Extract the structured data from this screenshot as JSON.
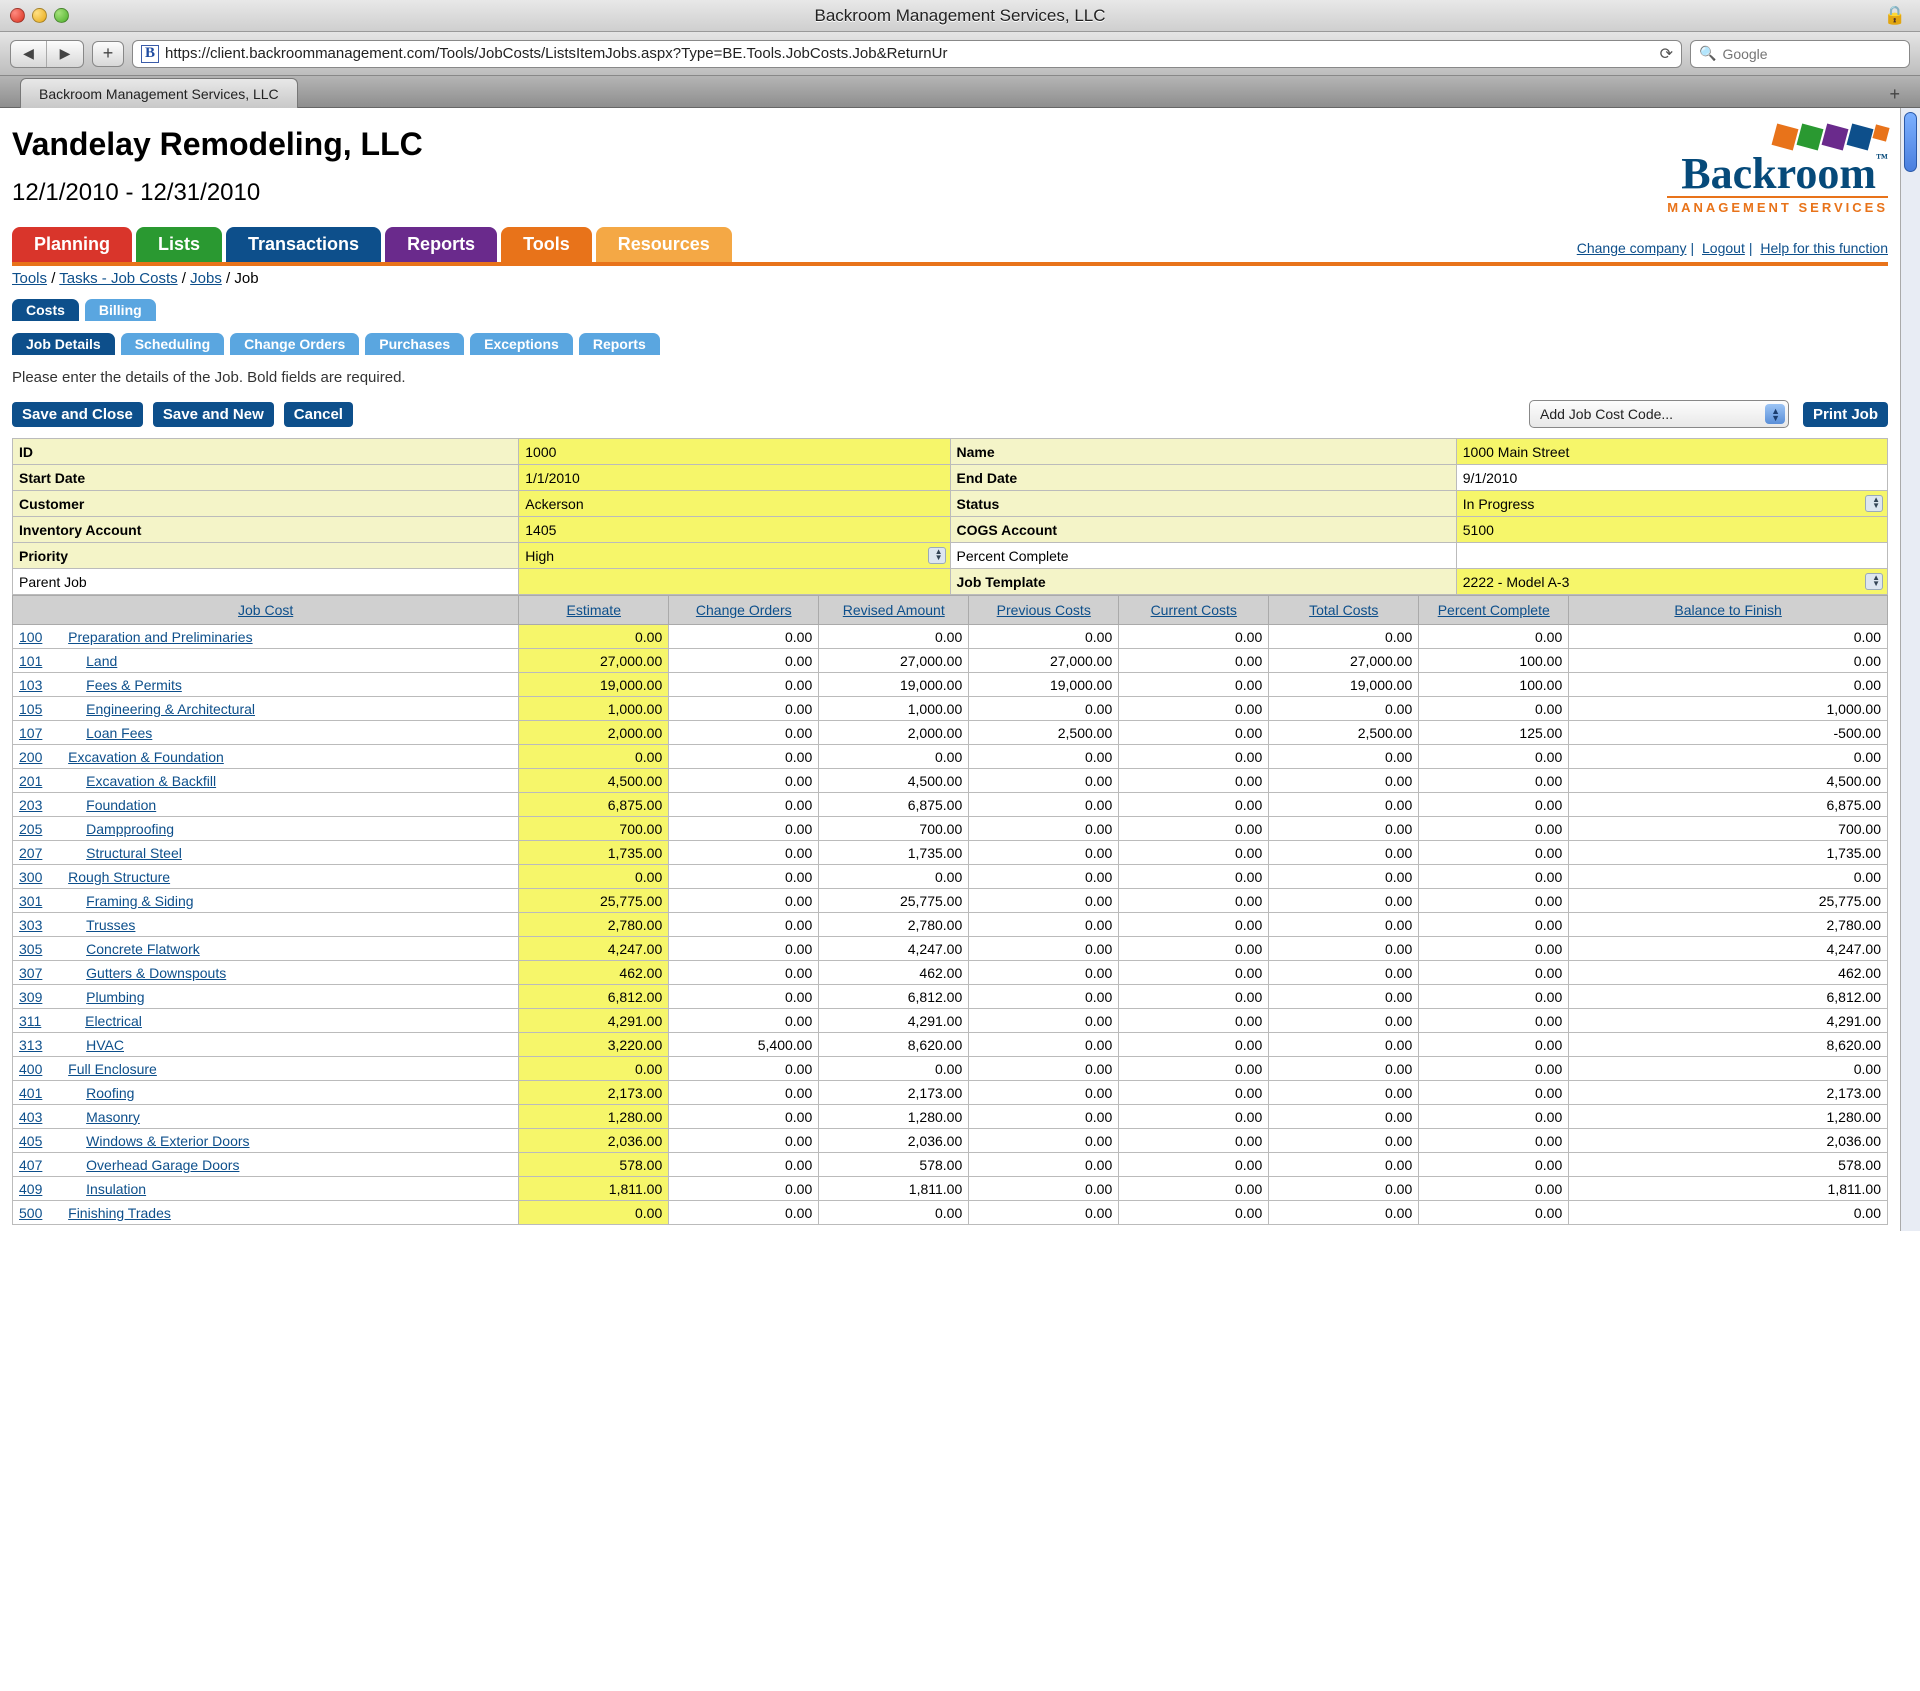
{
  "window": {
    "title": "Backroom Management Services, LLC",
    "tab_label": "Backroom Management Services, LLC",
    "url": "https://client.backroommanagement.com/Tools/JobCosts/ListsItemJobs.aspx?Type=BE.Tools.JobCosts.Job&ReturnUr",
    "search_placeholder": "Google",
    "favicon_letter": "B"
  },
  "header": {
    "company": "Vandelay Remodeling, LLC",
    "date_range": "12/1/2010 - 12/31/2010",
    "logo_main": "Backroom",
    "logo_sub": "MANAGEMENT SERVICES"
  },
  "main_nav": [
    "Planning",
    "Lists",
    "Transactions",
    "Reports",
    "Tools",
    "Resources"
  ],
  "top_links": {
    "change": "Change company",
    "logout": "Logout",
    "help": "Help for this function"
  },
  "breadcrumb": {
    "tools": "Tools",
    "tasks": "Tasks - Job Costs",
    "jobs": "Jobs",
    "last": "Job"
  },
  "tabs_row1": [
    "Costs",
    "Billing"
  ],
  "tabs_row2": [
    "Job Details",
    "Scheduling",
    "Change Orders",
    "Purchases",
    "Exceptions",
    "Reports"
  ],
  "instruction": "Please enter the details of the Job. Bold fields are required.",
  "buttons": {
    "save_close": "Save and Close",
    "save_new": "Save and New",
    "cancel": "Cancel",
    "print": "Print Job"
  },
  "dropdown_placeholder": "Add Job Cost Code...",
  "form": {
    "id_lbl": "ID",
    "id_val": "1000",
    "name_lbl": "Name",
    "name_val": "1000 Main Street",
    "start_lbl": "Start Date",
    "start_val": "1/1/2010",
    "end_lbl": "End Date",
    "end_val": "9/1/2010",
    "cust_lbl": "Customer",
    "cust_val": "Ackerson",
    "status_lbl": "Status",
    "status_val": "In Progress",
    "inv_lbl": "Inventory Account",
    "inv_val": "1405",
    "cogs_lbl": "COGS Account",
    "cogs_val": "5100",
    "prio_lbl": "Priority",
    "prio_val": "High",
    "pct_lbl": "Percent Complete",
    "pct_val": "",
    "parent_lbl": "Parent Job",
    "parent_val": "",
    "tmpl_lbl": "Job Template",
    "tmpl_val": "2222 - Model A-3"
  },
  "grid_headers": [
    "Job Cost",
    "Estimate",
    "Change Orders",
    "Revised Amount",
    "Previous Costs",
    "Current Costs",
    "Total Costs",
    "Percent Complete",
    "Balance to Finish"
  ],
  "rows": [
    {
      "code": "100",
      "desc": "Preparation and Preliminaries",
      "ind": 1,
      "est": "0.00",
      "co": "0.00",
      "rev": "0.00",
      "prev": "0.00",
      "cur": "0.00",
      "tot": "0.00",
      "pct": "0.00",
      "bal": "0.00"
    },
    {
      "code": "101",
      "desc": "Land",
      "ind": 2,
      "est": "27,000.00",
      "co": "0.00",
      "rev": "27,000.00",
      "prev": "27,000.00",
      "cur": "0.00",
      "tot": "27,000.00",
      "pct": "100.00",
      "bal": "0.00"
    },
    {
      "code": "103",
      "desc": "Fees & Permits",
      "ind": 2,
      "est": "19,000.00",
      "co": "0.00",
      "rev": "19,000.00",
      "prev": "19,000.00",
      "cur": "0.00",
      "tot": "19,000.00",
      "pct": "100.00",
      "bal": "0.00"
    },
    {
      "code": "105",
      "desc": "Engineering & Architectural",
      "ind": 2,
      "est": "1,000.00",
      "co": "0.00",
      "rev": "1,000.00",
      "prev": "0.00",
      "cur": "0.00",
      "tot": "0.00",
      "pct": "0.00",
      "bal": "1,000.00"
    },
    {
      "code": "107",
      "desc": "Loan Fees",
      "ind": 2,
      "est": "2,000.00",
      "co": "0.00",
      "rev": "2,000.00",
      "prev": "2,500.00",
      "cur": "0.00",
      "tot": "2,500.00",
      "pct": "125.00",
      "bal": "-500.00"
    },
    {
      "code": "200",
      "desc": "Excavation & Foundation",
      "ind": 1,
      "est": "0.00",
      "co": "0.00",
      "rev": "0.00",
      "prev": "0.00",
      "cur": "0.00",
      "tot": "0.00",
      "pct": "0.00",
      "bal": "0.00"
    },
    {
      "code": "201",
      "desc": "Excavation & Backfill",
      "ind": 2,
      "est": "4,500.00",
      "co": "0.00",
      "rev": "4,500.00",
      "prev": "0.00",
      "cur": "0.00",
      "tot": "0.00",
      "pct": "0.00",
      "bal": "4,500.00"
    },
    {
      "code": "203",
      "desc": "Foundation",
      "ind": 2,
      "est": "6,875.00",
      "co": "0.00",
      "rev": "6,875.00",
      "prev": "0.00",
      "cur": "0.00",
      "tot": "0.00",
      "pct": "0.00",
      "bal": "6,875.00"
    },
    {
      "code": "205",
      "desc": "Dampproofing",
      "ind": 2,
      "est": "700.00",
      "co": "0.00",
      "rev": "700.00",
      "prev": "0.00",
      "cur": "0.00",
      "tot": "0.00",
      "pct": "0.00",
      "bal": "700.00"
    },
    {
      "code": "207",
      "desc": "Structural Steel",
      "ind": 2,
      "est": "1,735.00",
      "co": "0.00",
      "rev": "1,735.00",
      "prev": "0.00",
      "cur": "0.00",
      "tot": "0.00",
      "pct": "0.00",
      "bal": "1,735.00"
    },
    {
      "code": "300",
      "desc": "Rough Structure",
      "ind": 1,
      "est": "0.00",
      "co": "0.00",
      "rev": "0.00",
      "prev": "0.00",
      "cur": "0.00",
      "tot": "0.00",
      "pct": "0.00",
      "bal": "0.00"
    },
    {
      "code": "301",
      "desc": "Framing & Siding",
      "ind": 2,
      "est": "25,775.00",
      "co": "0.00",
      "rev": "25,775.00",
      "prev": "0.00",
      "cur": "0.00",
      "tot": "0.00",
      "pct": "0.00",
      "bal": "25,775.00"
    },
    {
      "code": "303",
      "desc": "Trusses",
      "ind": 2,
      "est": "2,780.00",
      "co": "0.00",
      "rev": "2,780.00",
      "prev": "0.00",
      "cur": "0.00",
      "tot": "0.00",
      "pct": "0.00",
      "bal": "2,780.00"
    },
    {
      "code": "305",
      "desc": "Concrete Flatwork",
      "ind": 2,
      "est": "4,247.00",
      "co": "0.00",
      "rev": "4,247.00",
      "prev": "0.00",
      "cur": "0.00",
      "tot": "0.00",
      "pct": "0.00",
      "bal": "4,247.00"
    },
    {
      "code": "307",
      "desc": "Gutters & Downspouts",
      "ind": 2,
      "est": "462.00",
      "co": "0.00",
      "rev": "462.00",
      "prev": "0.00",
      "cur": "0.00",
      "tot": "0.00",
      "pct": "0.00",
      "bal": "462.00"
    },
    {
      "code": "309",
      "desc": "Plumbing",
      "ind": 2,
      "est": "6,812.00",
      "co": "0.00",
      "rev": "6,812.00",
      "prev": "0.00",
      "cur": "0.00",
      "tot": "0.00",
      "pct": "0.00",
      "bal": "6,812.00"
    },
    {
      "code": "311",
      "desc": "Electrical",
      "ind": 2,
      "est": "4,291.00",
      "co": "0.00",
      "rev": "4,291.00",
      "prev": "0.00",
      "cur": "0.00",
      "tot": "0.00",
      "pct": "0.00",
      "bal": "4,291.00"
    },
    {
      "code": "313",
      "desc": "HVAC",
      "ind": 2,
      "est": "3,220.00",
      "co": "5,400.00",
      "rev": "8,620.00",
      "prev": "0.00",
      "cur": "0.00",
      "tot": "0.00",
      "pct": "0.00",
      "bal": "8,620.00"
    },
    {
      "code": "400",
      "desc": "Full Enclosure",
      "ind": 1,
      "est": "0.00",
      "co": "0.00",
      "rev": "0.00",
      "prev": "0.00",
      "cur": "0.00",
      "tot": "0.00",
      "pct": "0.00",
      "bal": "0.00"
    },
    {
      "code": "401",
      "desc": "Roofing",
      "ind": 2,
      "est": "2,173.00",
      "co": "0.00",
      "rev": "2,173.00",
      "prev": "0.00",
      "cur": "0.00",
      "tot": "0.00",
      "pct": "0.00",
      "bal": "2,173.00"
    },
    {
      "code": "403",
      "desc": "Masonry",
      "ind": 2,
      "est": "1,280.00",
      "co": "0.00",
      "rev": "1,280.00",
      "prev": "0.00",
      "cur": "0.00",
      "tot": "0.00",
      "pct": "0.00",
      "bal": "1,280.00"
    },
    {
      "code": "405",
      "desc": "Windows & Exterior Doors",
      "ind": 2,
      "est": "2,036.00",
      "co": "0.00",
      "rev": "2,036.00",
      "prev": "0.00",
      "cur": "0.00",
      "tot": "0.00",
      "pct": "0.00",
      "bal": "2,036.00"
    },
    {
      "code": "407",
      "desc": "Overhead Garage Doors",
      "ind": 2,
      "est": "578.00",
      "co": "0.00",
      "rev": "578.00",
      "prev": "0.00",
      "cur": "0.00",
      "tot": "0.00",
      "pct": "0.00",
      "bal": "578.00"
    },
    {
      "code": "409",
      "desc": "Insulation",
      "ind": 2,
      "est": "1,811.00",
      "co": "0.00",
      "rev": "1,811.00",
      "prev": "0.00",
      "cur": "0.00",
      "tot": "0.00",
      "pct": "0.00",
      "bal": "1,811.00"
    },
    {
      "code": "500",
      "desc": "Finishing Trades",
      "ind": 1,
      "est": "0.00",
      "co": "0.00",
      "rev": "0.00",
      "prev": "0.00",
      "cur": "0.00",
      "tot": "0.00",
      "pct": "0.00",
      "bal": "0.00"
    }
  ]
}
